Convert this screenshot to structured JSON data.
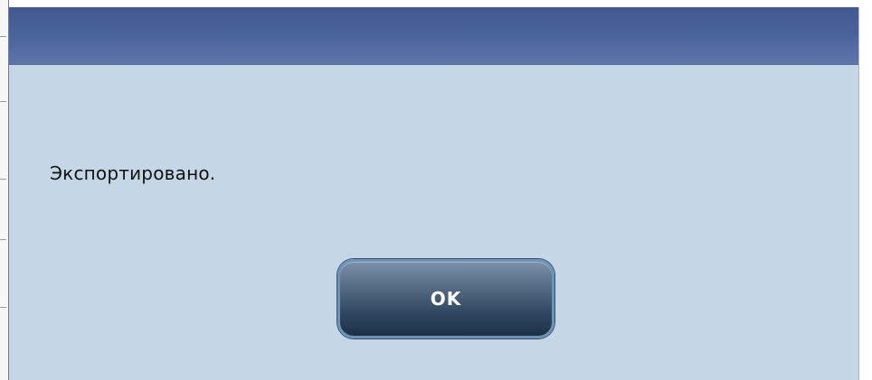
{
  "dialog": {
    "title": "",
    "message": "Экспортировано.",
    "ok_label": "OK"
  },
  "colors": {
    "dialog_background": "#c5d6e7",
    "titlebar": "#4a629a",
    "button_dark": "#1d3048",
    "button_border": "#6f93b4",
    "text": "#111111",
    "button_text": "#ffffff"
  }
}
